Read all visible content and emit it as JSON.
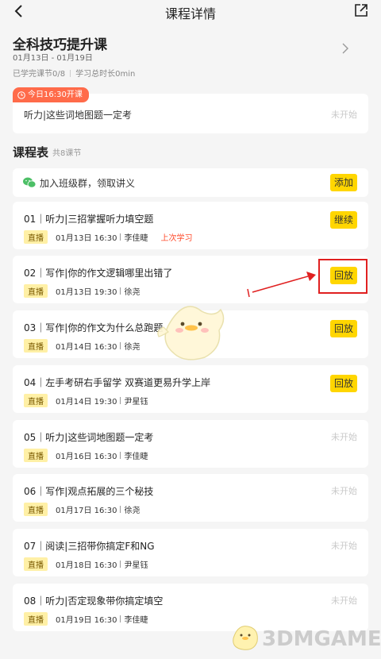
{
  "header": {
    "title": "课程详情",
    "back_icon": "back-arrow-icon",
    "share_icon": "share-icon"
  },
  "course": {
    "title": "全科技巧提升课",
    "dates": "01月13日 - 01月19日",
    "completed": "已学完课节0/8",
    "total_time": "学习总时长0min"
  },
  "today": {
    "badge": "今日16:30开课",
    "lesson": "听力|这些词地图题一定考",
    "status": "未开始"
  },
  "schedule": {
    "title": "课程表",
    "count": "共8课节",
    "group_text": "加入班级群，领取讲义",
    "group_button": "添加"
  },
  "lessons": [
    {
      "title": "01｜听力|三招掌握听力填空题",
      "tag": "直播",
      "date": "01月13日 16:30",
      "teacher": "李佳睫",
      "extra": "上次学习",
      "action": "继续"
    },
    {
      "title": "02｜写作|你的作文逻辑哪里出错了",
      "tag": "直播",
      "date": "01月13日 19:30",
      "teacher": "徐尧",
      "action": "回放"
    },
    {
      "title": "03｜写作|你的作文为什么总跑题",
      "tag": "直播",
      "date": "01月14日 16:30",
      "teacher": "徐尧",
      "action": "回放"
    },
    {
      "title": "04｜左手考研右手留学 双赛道更易升学上岸",
      "tag": "直播",
      "date": "01月14日 19:30",
      "teacher": "尹星钰",
      "action": "回放"
    },
    {
      "title": "05｜听力|这些词地图题一定考",
      "tag": "直播",
      "date": "01月16日 16:30",
      "teacher": "李佳睫",
      "status": "未开始"
    },
    {
      "title": "06｜写作|观点拓展的三个秘技",
      "tag": "直播",
      "date": "01月17日 16:30",
      "teacher": "徐尧",
      "status": "未开始"
    },
    {
      "title": "07｜阅读|三招带你搞定F和NG",
      "tag": "直播",
      "date": "01月18日 16:30",
      "teacher": "尹星钰",
      "status": "未开始"
    },
    {
      "title": "08｜听力|否定现象带你搞定填空",
      "tag": "直播",
      "date": "01月19日 16:30",
      "teacher": "李佳睫",
      "status": "未开始"
    }
  ],
  "watermark": "3DMGAME",
  "colors": {
    "accent_yellow": "#ffd600",
    "badge_orange": "#ff6b4a",
    "highlight_red": "#e02020",
    "last_study_red": "#ff4b2b"
  }
}
